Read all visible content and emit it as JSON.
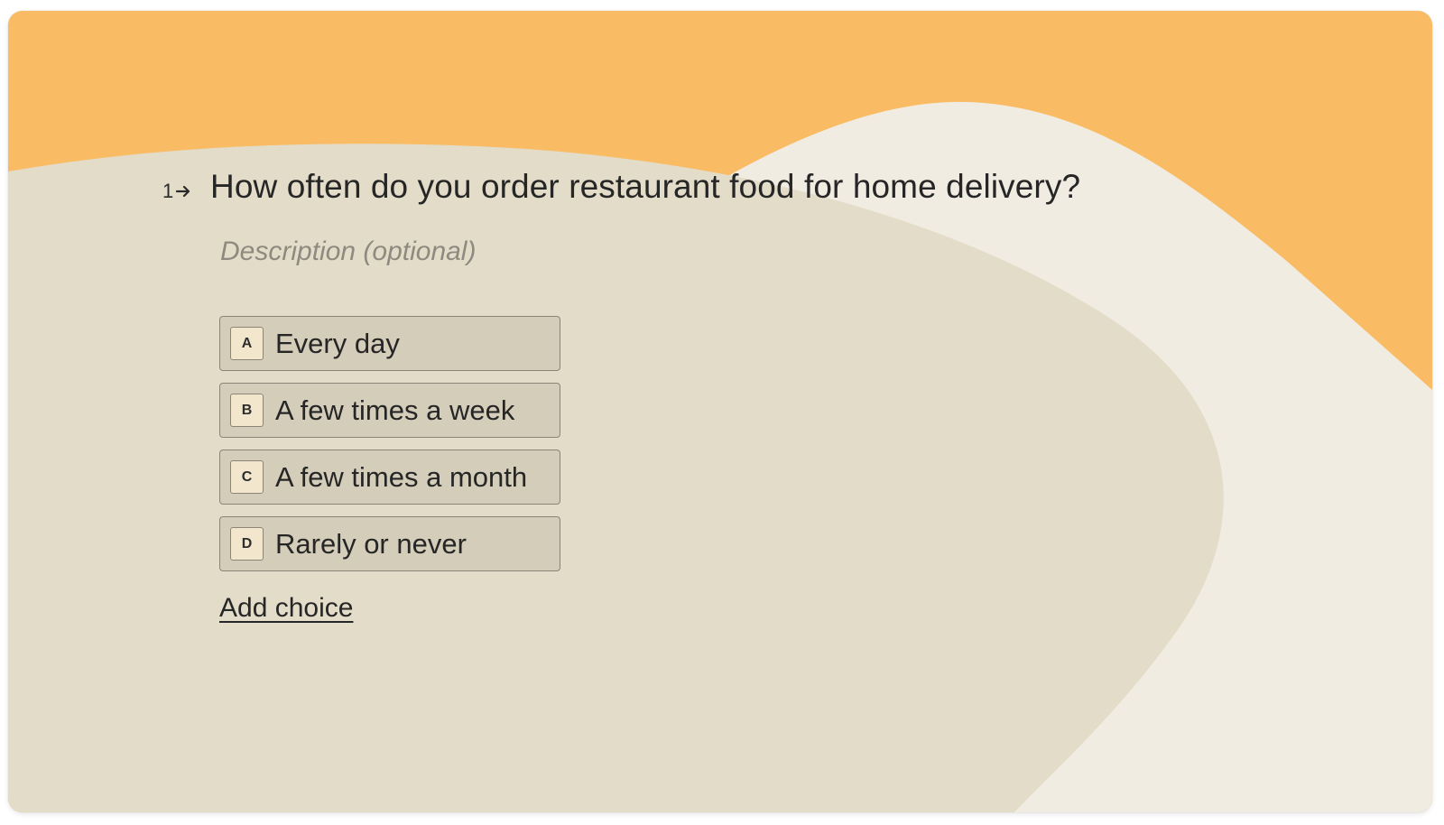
{
  "question": {
    "number": "1",
    "arrow_icon": "arrow-right-icon",
    "title": "How often do you order restaurant food for home delivery?",
    "description_placeholder": "Description (optional)"
  },
  "choices": [
    {
      "key": "A",
      "label": "Every day"
    },
    {
      "key": "B",
      "label": "A few times a week"
    },
    {
      "key": "C",
      "label": "A few times a month"
    },
    {
      "key": "D",
      "label": "Rarely or never"
    }
  ],
  "add_choice_label": "Add choice",
  "colors": {
    "background_orange": "#f9bb63",
    "blob_light": "#f1ece2",
    "blob_beige": "#e3dcc8",
    "choice_bg": "#d4cdb9",
    "key_bg": "#f2e6cd",
    "border": "#8c8577",
    "text": "#262626",
    "placeholder": "#8f8a80"
  }
}
